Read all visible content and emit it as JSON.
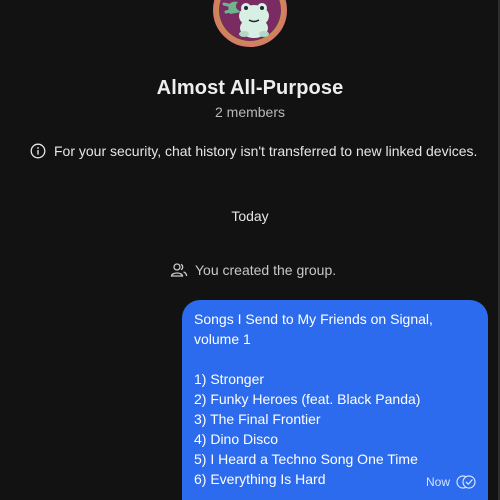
{
  "group": {
    "name": "Almost All-Purpose",
    "member_count": "2 members",
    "avatar_icon": "frog-avatar-icon"
  },
  "notice": {
    "text": "For your security, chat history isn't transferred to new linked devices.",
    "icon": "info-icon"
  },
  "divider": {
    "label": "Today"
  },
  "system_event": {
    "text": "You created the group.",
    "icon": "group-icon"
  },
  "message": {
    "title_line1": "Songs I Send to My Friends on Signal,",
    "title_line2": "volume 1",
    "items": [
      "1) Stronger",
      "2) Funky Heroes (feat. Black Panda)",
      "3) The Final Frontier",
      "4) Dino Disco",
      "5) I Heard a Techno Song One Time",
      "6) Everything Is Hard"
    ],
    "timestamp": "Now",
    "status_icon": "delivered-check-icon"
  },
  "colors": {
    "background": "#121212",
    "bubble": "#2c6bed",
    "avatar_ring": "#d67a6a",
    "avatar_fill": "#7a2b62"
  }
}
